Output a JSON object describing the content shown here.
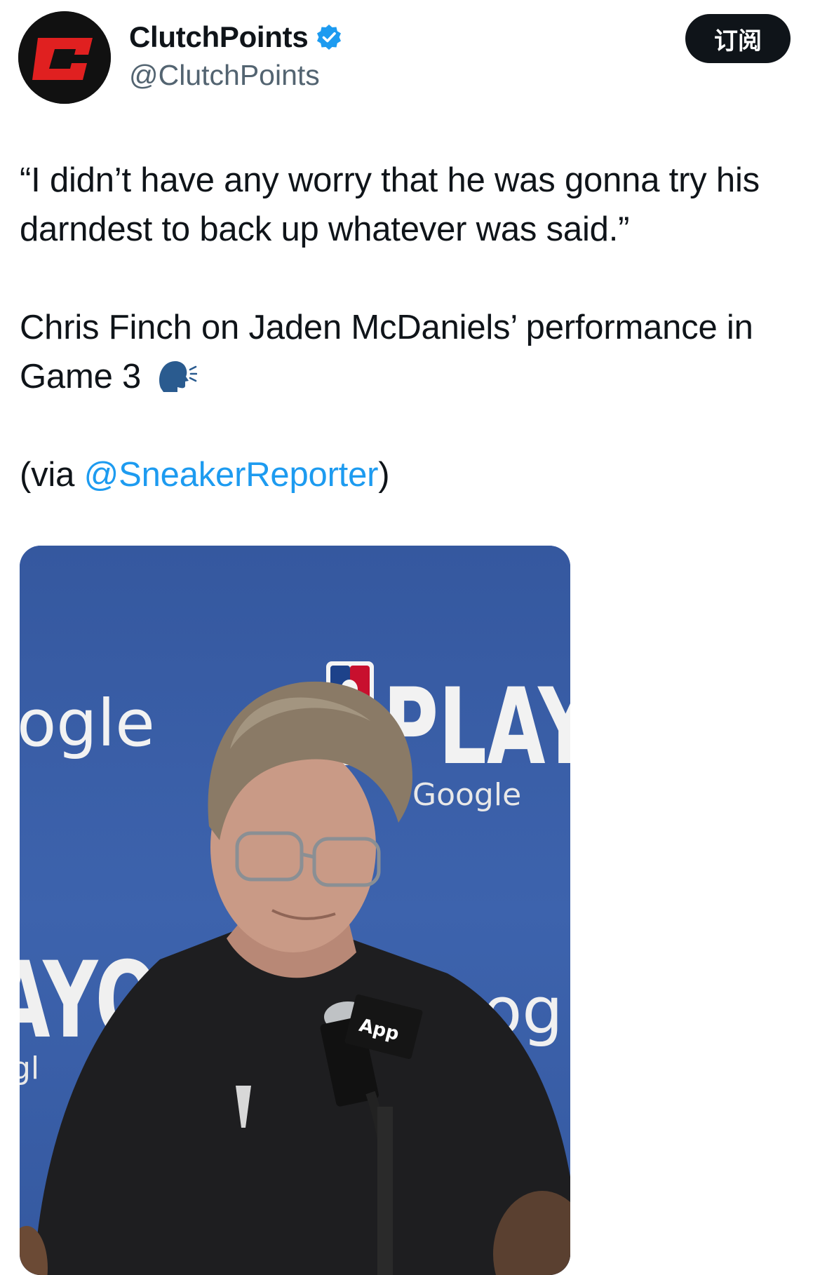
{
  "account": {
    "display_name": "ClutchPoints",
    "handle": "@ClutchPoints",
    "verified": true,
    "avatar_icon": "clutchpoints-logo-icon",
    "avatar_colors": {
      "background": "#111111",
      "mark": "#e02020"
    }
  },
  "header": {
    "subscribe_label": "订阅"
  },
  "tweet": {
    "quote": "“I didn’t have any worry that he was gonna try his darndest to back up whatever was said.”",
    "context_line1": "Chris Finch on Jaden McDaniels’ performance in",
    "context_line2": "Game 3",
    "context_emoji_icon": "speaking-head-icon",
    "via_prefix": "(via ",
    "via_mention": "@SneakerReporter",
    "via_suffix": ")"
  },
  "media": {
    "type": "video-still",
    "backdrop_text_google_left": "ogle",
    "backdrop_text_playoffs": "PLAYO",
    "backdrop_text_google_small": "Google",
    "backdrop_text_google_right": "og",
    "backdrop_text_playoffs_left": "AYO",
    "backdrop_text_google_left_small": "gl",
    "mic_label": "App",
    "colors": {
      "backdrop": "#3d63ad",
      "shirt": "#1e1e20",
      "skin": "#c99a86",
      "hair": "#8a7a66"
    }
  },
  "colors": {
    "text": "#0f1419",
    "secondary": "#536471",
    "link": "#1d9bf0",
    "verified_badge": "#1d9bf0"
  }
}
